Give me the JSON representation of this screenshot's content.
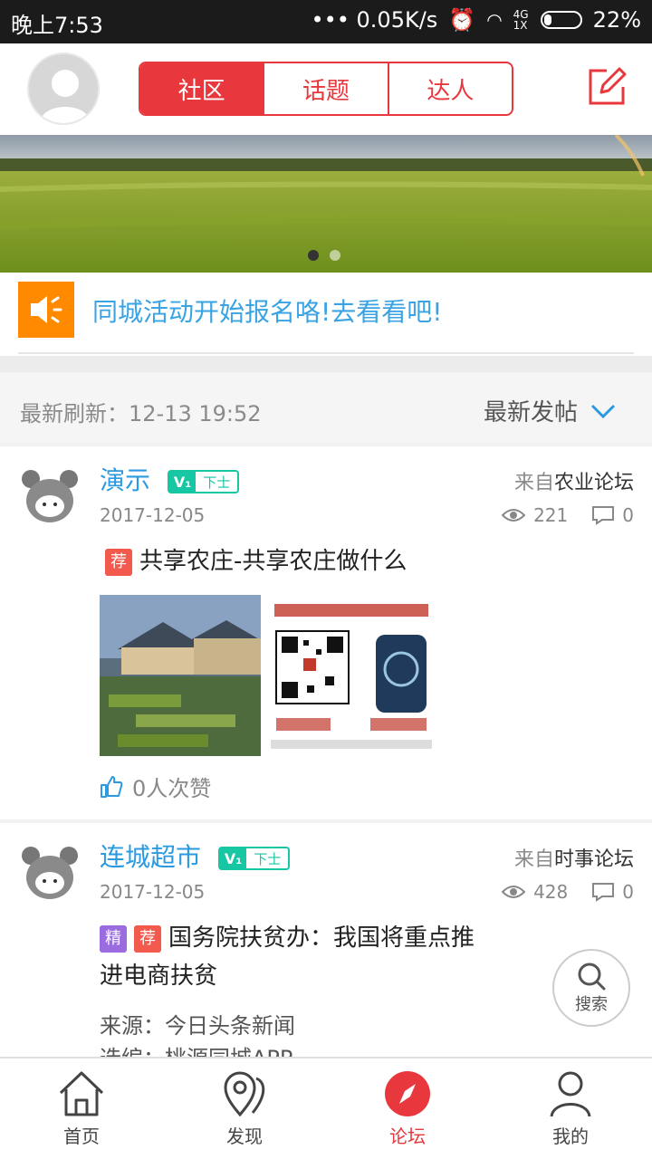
{
  "status_bar": {
    "time": "晚上7:53",
    "speed": "••• 0.05K/s",
    "network": "4G 1X",
    "battery": "22%"
  },
  "header": {
    "tabs": [
      "社区",
      "话题",
      "达人"
    ],
    "active_tab": 0,
    "avatar_icon": "user-avatar-placeholder",
    "edit_icon": "compose-icon",
    "accent_color": "#e8383d"
  },
  "banner": {
    "image": "wheat-field-landscape",
    "slide_count": 2,
    "active_slide": 0
  },
  "notice": {
    "icon": "speaker-icon",
    "text": "同城活动开始报名咯!去看看吧!"
  },
  "filter": {
    "refresh_text": "最新刷新：12-13 19:52",
    "sort_label": "最新发帖"
  },
  "posts": [
    {
      "username": "演示",
      "badge_v": "V₁",
      "badge_level": "下士",
      "from_prefix": "来自",
      "from_forum": "农业论坛",
      "date": "2017-12-05",
      "views": "221",
      "comments": "0",
      "tags": [
        "荐"
      ],
      "title": "共享农庄-共享农庄做什么",
      "likes": "0人次赞"
    },
    {
      "username": "连城超市",
      "badge_v": "V₁",
      "badge_level": "下士",
      "from_prefix": "来自",
      "from_forum": "时事论坛",
      "date": "2017-12-05",
      "views": "428",
      "comments": "0",
      "tags": [
        "精",
        "荐"
      ],
      "title": "国务院扶贫办：我国将重点推进电商扶贫",
      "source_line": "来源：今日头条新闻",
      "editor_line": "选编：桃源同城APP"
    }
  ],
  "search_fab": {
    "label": "搜索"
  },
  "tabbar": {
    "items": [
      "首页",
      "发现",
      "论坛",
      "我的"
    ],
    "active": 2
  }
}
